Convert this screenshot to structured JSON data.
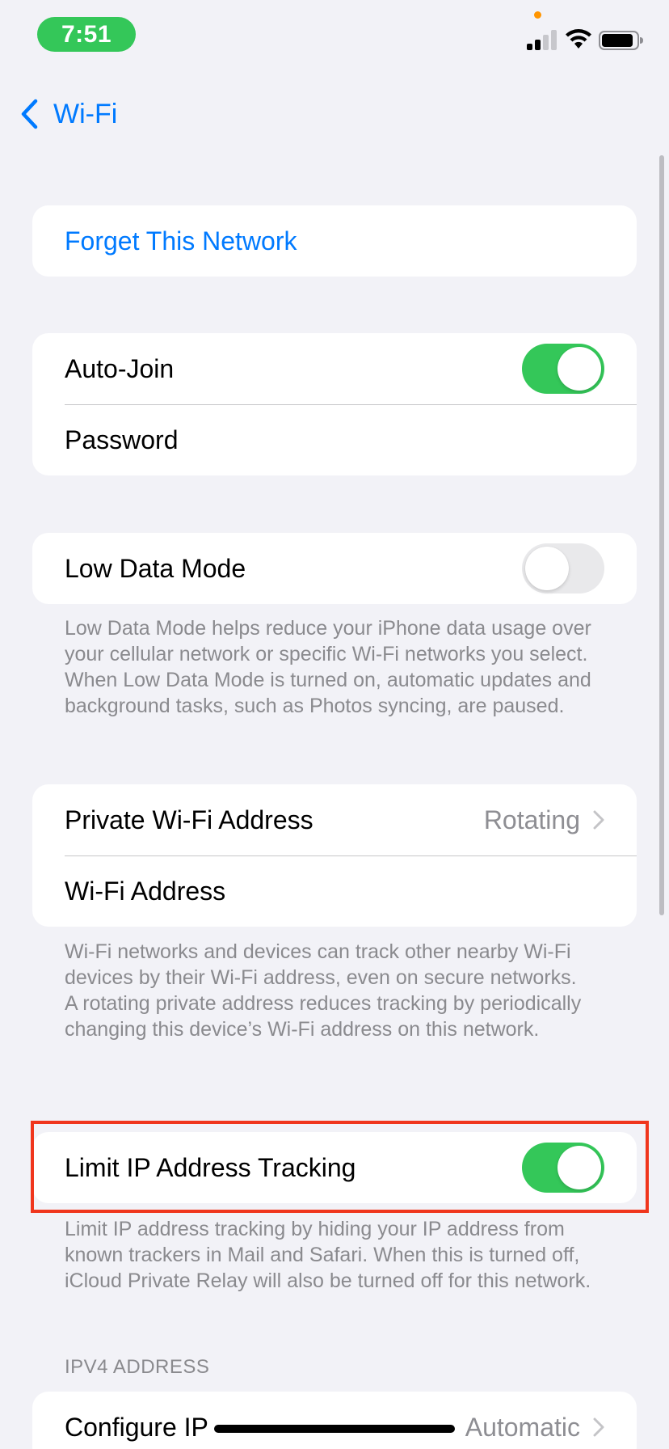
{
  "status_bar": {
    "time": "7:51",
    "colors": {
      "time_pill": "#34C759",
      "privacy_dot": "#FF9500"
    },
    "icons": [
      "cellular-signal-icon",
      "wifi-icon",
      "battery-icon"
    ]
  },
  "nav": {
    "back_label": "Wi-Fi",
    "back_icon": "chevron-left-icon"
  },
  "forget": {
    "label": "Forget This Network"
  },
  "join_group": {
    "auto_join": {
      "label": "Auto-Join",
      "on": true
    },
    "password": {
      "label": "Password"
    }
  },
  "low_data": {
    "label": "Low Data Mode",
    "on": false,
    "footnote": "Low Data Mode helps reduce your iPhone data usage over your cellular network or specific Wi-Fi networks you select. When Low Data Mode is turned on, automatic updates and background tasks, such as Photos syncing, are paused."
  },
  "address_group": {
    "private_address": {
      "label": "Private Wi-Fi Address",
      "value": "Rotating"
    },
    "wifi_address": {
      "label": "Wi-Fi Address"
    },
    "footnote_1": "Wi-Fi networks and devices can track other nearby Wi-Fi devices by their Wi-Fi address, even on secure networks.",
    "footnote_2": "A rotating private address reduces tracking by periodically changing this device’s Wi-Fi address on this network."
  },
  "limit_ip": {
    "label": "Limit IP Address Tracking",
    "on": true,
    "footnote": "Limit IP address tracking by hiding your IP address from known trackers in Mail and Safari. When this is turned off, iCloud Private Relay will also be turned off for this network."
  },
  "ipv4": {
    "header": "IPV4 ADDRESS",
    "configure_ip": {
      "label": "Configure IP",
      "value": "Automatic"
    }
  },
  "colors": {
    "accent": "#007AFF",
    "toggle_on": "#34C759",
    "toggle_off": "#E9E9EB",
    "highlight": "#F0361D",
    "background": "#F2F2F7"
  }
}
